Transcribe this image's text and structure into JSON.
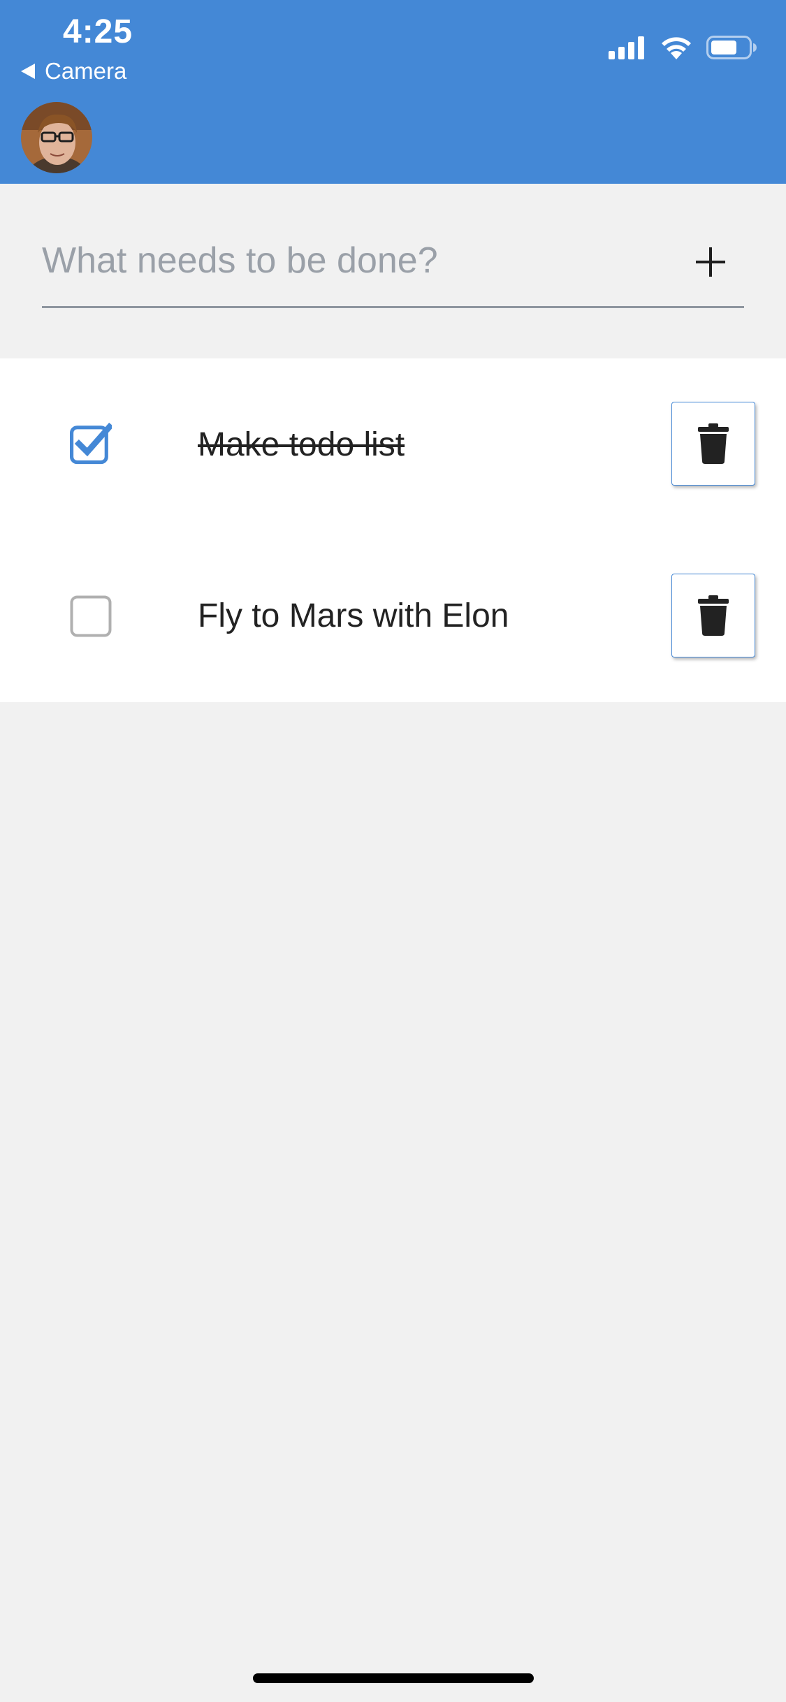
{
  "status_bar": {
    "time": "4:25",
    "back_label": "Camera"
  },
  "header": {
    "background_color": "#4488d6",
    "avatar_alt": "User avatar"
  },
  "new_todo": {
    "placeholder": "What needs to be done?",
    "value": "",
    "add_icon": "plus-icon"
  },
  "todos": [
    {
      "text": "Make todo list",
      "completed": true,
      "delete_icon": "trash-icon"
    },
    {
      "text": "Fly to Mars with Elon",
      "completed": false,
      "delete_icon": "trash-icon"
    }
  ],
  "colors": {
    "accent": "#4488d6",
    "background": "#f1f1f1",
    "list_background": "#ffffff"
  }
}
